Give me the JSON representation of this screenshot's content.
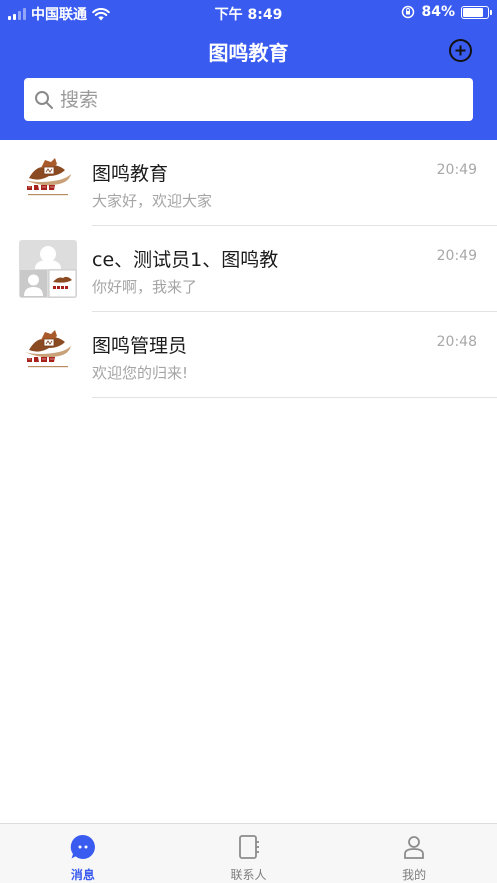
{
  "status_bar": {
    "carrier": "中国联通",
    "time": "下午 8:49",
    "battery": "84%",
    "battery_level": 0.84,
    "signal_bars": 2
  },
  "nav": {
    "title": "图鸣教育",
    "add_icon": "plus-circle-icon"
  },
  "search": {
    "placeholder": "搜索",
    "icon": "search-icon"
  },
  "conversations": [
    {
      "name": "图鸣教育",
      "last_message": "大家好，欢迎大家",
      "time": "20:49",
      "avatar": "brand-logo"
    },
    {
      "name": "ce、测试员1、图鸣教",
      "last_message": "你好啊，我来了",
      "time": "20:49",
      "avatar": "group-avatar"
    },
    {
      "name": "图鸣管理员",
      "last_message": "欢迎您的归来!",
      "time": "20:48",
      "avatar": "brand-logo"
    }
  ],
  "tabs": [
    {
      "label": "消息",
      "icon": "chat-bubble-icon",
      "active": true
    },
    {
      "label": "联系人",
      "icon": "contacts-book-icon",
      "active": false
    },
    {
      "label": "我的",
      "icon": "person-icon",
      "active": false
    }
  ],
  "colors": {
    "primary": "#3a5bf0",
    "logo_brown": "#7a3e1a",
    "logo_red": "#a8201a"
  }
}
